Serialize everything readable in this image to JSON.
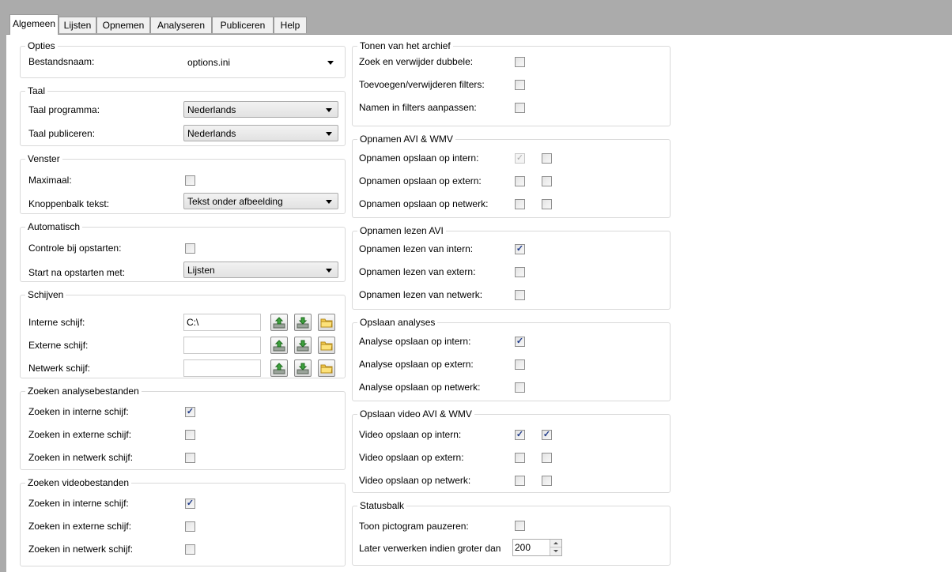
{
  "tabs": [
    "Algemeen",
    "Lijsten",
    "Opnemen",
    "Analyseren",
    "Publiceren",
    "Help"
  ],
  "opties": {
    "title": "Opties",
    "bestandsnaam_label": "Bestandsnaam:",
    "bestandsnaam_value": "options.ini"
  },
  "taal": {
    "title": "Taal",
    "programma_label": "Taal programma:",
    "programma_value": "Nederlands",
    "publiceren_label": "Taal publiceren:",
    "publiceren_value": "Nederlands"
  },
  "venster": {
    "title": "Venster",
    "maximaal_label": "Maximaal:",
    "maximaal_checked": false,
    "knoppenbalk_label": "Knoppenbalk tekst:",
    "knoppenbalk_value": "Tekst onder afbeelding"
  },
  "automatisch": {
    "title": "Automatisch",
    "controle_label": "Controle bij opstarten:",
    "controle_checked": false,
    "start_label": "Start na opstarten met:",
    "start_value": "Lijsten"
  },
  "schijven": {
    "title": "Schijven",
    "rows": [
      {
        "label": "Interne schijf:",
        "value": "C:\\"
      },
      {
        "label": "Externe schijf:",
        "value": ""
      },
      {
        "label": "Netwerk schijf:",
        "value": ""
      }
    ]
  },
  "zoeken_analyse": {
    "title": "Zoeken analysebestanden",
    "rows": [
      {
        "label": "Zoeken in interne schijf:",
        "checked": true
      },
      {
        "label": "Zoeken in externe schijf:",
        "checked": false
      },
      {
        "label": "Zoeken in netwerk schijf:",
        "checked": false
      }
    ]
  },
  "zoeken_video": {
    "title": "Zoeken videobestanden",
    "rows": [
      {
        "label": "Zoeken in interne schijf:",
        "checked": true
      },
      {
        "label": "Zoeken in externe schijf:",
        "checked": false
      },
      {
        "label": "Zoeken in netwerk schijf:",
        "checked": false
      }
    ]
  },
  "tonen_archief": {
    "title": "Tonen van het archief",
    "rows": [
      {
        "label": "Zoek en verwijder dubbele:",
        "checked": false
      },
      {
        "label": "Toevoegen/verwijderen filters:",
        "checked": false
      },
      {
        "label": "Namen in filters aanpassen:",
        "checked": false
      }
    ]
  },
  "opnamen_avi_wmv": {
    "title": "Opnamen AVI & WMV",
    "rows": [
      {
        "label": "Opnamen opslaan op intern:",
        "c1": true,
        "c1_disabled": true,
        "c2": false
      },
      {
        "label": "Opnamen opslaan op extern:",
        "c1": false,
        "c1_disabled": false,
        "c2": false
      },
      {
        "label": "Opnamen opslaan op netwerk:",
        "c1": false,
        "c1_disabled": false,
        "c2": false
      }
    ]
  },
  "opnamen_lezen": {
    "title": "Opnamen lezen AVI",
    "rows": [
      {
        "label": "Opnamen lezen van intern:",
        "checked": true
      },
      {
        "label": "Opnamen lezen van extern:",
        "checked": false
      },
      {
        "label": "Opnamen lezen van netwerk:",
        "checked": false
      }
    ]
  },
  "opslaan_analyses": {
    "title": "Opslaan analyses",
    "rows": [
      {
        "label": "Analyse opslaan op intern:",
        "checked": true
      },
      {
        "label": "Analyse opslaan op extern:",
        "checked": false
      },
      {
        "label": "Analyse opslaan op netwerk:",
        "checked": false
      }
    ]
  },
  "opslaan_video": {
    "title": "Opslaan video AVI & WMV",
    "rows": [
      {
        "label": "Video opslaan op intern:",
        "c1": true,
        "c2": true
      },
      {
        "label": "Video opslaan op extern:",
        "c1": false,
        "c2": false
      },
      {
        "label": "Video opslaan op netwerk:",
        "c1": false,
        "c2": false
      }
    ]
  },
  "statusbalk": {
    "title": "Statusbalk",
    "toon_label": "Toon pictogram pauzeren:",
    "toon_checked": false,
    "later_label": "Later verwerken indien groter dan",
    "later_value": "200"
  },
  "colors": {
    "tab_bg": "#f0f0f0",
    "page_bg": "#ffffff",
    "window_bg": "#ababab",
    "group_border": "#d9d9d9",
    "check_color": "#1e3a8a"
  },
  "icons": {
    "upload": "drive-upload-icon",
    "download": "drive-download-icon",
    "folder": "folder-open-icon"
  }
}
